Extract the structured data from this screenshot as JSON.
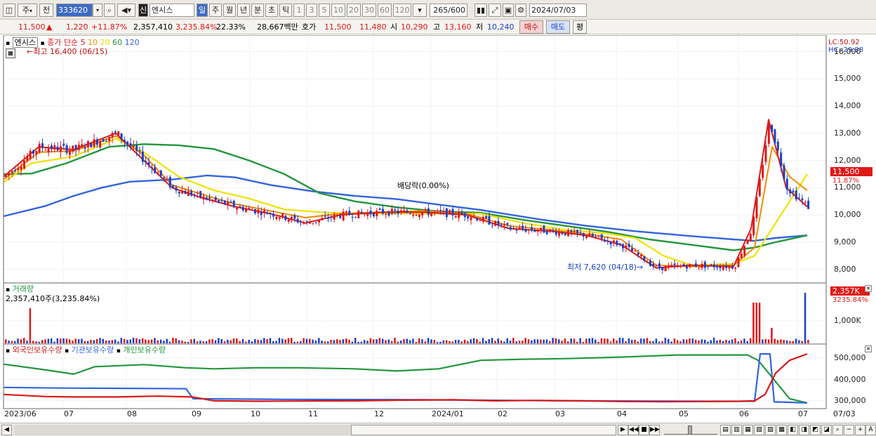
{
  "toolbar": {
    "market_type": "주",
    "prev_label": "전",
    "code": "333620",
    "stock_name": "엔시스",
    "period_tabs": [
      "일",
      "주",
      "월",
      "년",
      "분",
      "초",
      "틱"
    ],
    "interval_buttons": [
      "1",
      "3",
      "5",
      "10",
      "20",
      "30",
      "60",
      "120"
    ],
    "count": "265",
    "count_max": "/600",
    "date": "2024/07/03",
    "badge": "신"
  },
  "quote": {
    "price": "11,500",
    "arrow": "▲",
    "change": "1,220",
    "change_pct": "+11.87%",
    "volume": "2,357,410",
    "volume_ratio": "3,235.84%",
    "turnover": "22.33%",
    "amount": "28,667백만",
    "bid_label": "호가",
    "ask_price": "11,500",
    "bid_price": "11,480",
    "open_label": "시",
    "open": "10,290",
    "high_label": "고",
    "high": "13,160",
    "low_label": "저",
    "low": "10,240",
    "buy_button": "매수",
    "sell_button": "매도",
    "eval_button": "평"
  },
  "price_panel": {
    "name_tag": "엔시스",
    "legend_prefix": "종가 단순",
    "ma_labels": [
      {
        "label": "5",
        "color": "#e01818"
      },
      {
        "label": "10",
        "color": "#f08c00"
      },
      {
        "label": "20",
        "color": "#e8d800"
      },
      {
        "label": "60",
        "color": "#23963c"
      },
      {
        "label": "120",
        "color": "#3264dc"
      }
    ],
    "high_note": "최고 16,400 (06/15)",
    "low_note": "최저 7,620 (04/18)",
    "dividend_note": "배당락(0.00%)",
    "lc": "LC:50.92",
    "hc": "HC:-29.88",
    "current_price_tag": "11,500",
    "current_pct_tag": "11.87%",
    "y_ticks": [
      "16,000",
      "15,000",
      "14,000",
      "13,000",
      "12,000",
      "11,000",
      "10,000",
      "9,000",
      "8,000"
    ]
  },
  "volume_panel": {
    "title": "거래량",
    "value": "2,357,410주(3,235.84%)",
    "tag_value": "2,357K",
    "tag_pct": "3235.84%",
    "y_ticks": [
      "1,000K"
    ]
  },
  "holding_panel": {
    "legend": [
      {
        "label": "외국인보유수량",
        "color": "#d81818"
      },
      {
        "label": "기관보유수량",
        "color": "#3264dc"
      },
      {
        "label": "개인보유수량",
        "color": "#23963c"
      }
    ],
    "y_ticks": [
      "500,000",
      "400,000",
      "300,000"
    ]
  },
  "x_axis": [
    "2023/06",
    "07",
    "08",
    "09",
    "10",
    "11",
    "12",
    "2024/01",
    "02",
    "03",
    "04",
    "05",
    "06",
    "07",
    "07/03"
  ],
  "colors": {
    "up": "#e01818",
    "down": "#1c3fc8",
    "ma5": "#e01818",
    "ma10": "#f08c00",
    "ma20": "#f0e000",
    "ma60": "#23963c",
    "ma120": "#3264dc"
  },
  "chart_data": {
    "type": "candlestick",
    "ylim": [
      7500,
      16400
    ],
    "ma120": [
      [
        0,
        9950
      ],
      [
        60,
        10330
      ],
      [
        100,
        10700
      ],
      [
        140,
        11000
      ],
      [
        180,
        11220
      ],
      [
        240,
        11300
      ],
      [
        290,
        11450
      ],
      [
        330,
        11380
      ],
      [
        380,
        11100
      ],
      [
        440,
        10870
      ],
      [
        500,
        10700
      ],
      [
        560,
        10580
      ],
      [
        620,
        10380
      ],
      [
        680,
        10180
      ],
      [
        760,
        9850
      ],
      [
        830,
        9600
      ],
      [
        900,
        9400
      ],
      [
        980,
        9220
      ],
      [
        1040,
        9100
      ],
      [
        1070,
        9050
      ],
      [
        1100,
        9150
      ],
      [
        1145,
        9250
      ]
    ],
    "ma60": [
      [
        0,
        11500
      ],
      [
        40,
        11520
      ],
      [
        90,
        11900
      ],
      [
        150,
        12500
      ],
      [
        200,
        12600
      ],
      [
        250,
        12560
      ],
      [
        300,
        12420
      ],
      [
        350,
        12000
      ],
      [
        400,
        11500
      ],
      [
        450,
        10800
      ],
      [
        500,
        10500
      ],
      [
        560,
        10280
      ],
      [
        620,
        10130
      ],
      [
        680,
        10080
      ],
      [
        740,
        9820
      ],
      [
        800,
        9600
      ],
      [
        860,
        9380
      ],
      [
        920,
        9100
      ],
      [
        980,
        8900
      ],
      [
        1040,
        8700
      ],
      [
        1070,
        8800
      ],
      [
        1100,
        9000
      ],
      [
        1145,
        9250
      ]
    ],
    "ma20": [
      [
        0,
        11200
      ],
      [
        40,
        11900
      ],
      [
        100,
        12150
      ],
      [
        160,
        12800
      ],
      [
        200,
        12300
      ],
      [
        250,
        11400
      ],
      [
        300,
        10900
      ],
      [
        350,
        10600
      ],
      [
        400,
        10200
      ],
      [
        450,
        10100
      ],
      [
        500,
        10050
      ],
      [
        560,
        10050
      ],
      [
        620,
        10050
      ],
      [
        680,
        10050
      ],
      [
        740,
        9700
      ],
      [
        800,
        9450
      ],
      [
        860,
        9320
      ],
      [
        900,
        9150
      ],
      [
        940,
        8500
      ],
      [
        980,
        8150
      ],
      [
        1040,
        8200
      ],
      [
        1070,
        8500
      ],
      [
        1100,
        9700
      ],
      [
        1145,
        11500
      ]
    ],
    "ma10": [
      [
        0,
        11300
      ],
      [
        50,
        12300
      ],
      [
        100,
        12350
      ],
      [
        160,
        12900
      ],
      [
        200,
        12200
      ],
      [
        240,
        11100
      ],
      [
        290,
        10700
      ],
      [
        330,
        10400
      ],
      [
        380,
        10150
      ],
      [
        430,
        9900
      ],
      [
        480,
        10050
      ],
      [
        540,
        10100
      ],
      [
        600,
        10150
      ],
      [
        660,
        10050
      ],
      [
        720,
        9600
      ],
      [
        780,
        9450
      ],
      [
        830,
        9300
      ],
      [
        880,
        9100
      ],
      [
        930,
        8150
      ],
      [
        980,
        8100
      ],
      [
        1040,
        8150
      ],
      [
        1070,
        8800
      ],
      [
        1095,
        12500
      ],
      [
        1120,
        11400
      ],
      [
        1145,
        10900
      ]
    ],
    "ma5": [
      [
        0,
        11400
      ],
      [
        50,
        12500
      ],
      [
        100,
        12400
      ],
      [
        160,
        13000
      ],
      [
        200,
        12000
      ],
      [
        240,
        11000
      ],
      [
        280,
        10650
      ],
      [
        330,
        10300
      ],
      [
        380,
        10050
      ],
      [
        430,
        9700
      ],
      [
        480,
        10000
      ],
      [
        540,
        10100
      ],
      [
        600,
        10100
      ],
      [
        660,
        10000
      ],
      [
        720,
        9500
      ],
      [
        780,
        9400
      ],
      [
        830,
        9250
      ],
      [
        880,
        8900
      ],
      [
        930,
        8050
      ],
      [
        980,
        8150
      ],
      [
        1040,
        8100
      ],
      [
        1065,
        9500
      ],
      [
        1090,
        13500
      ],
      [
        1115,
        11000
      ],
      [
        1145,
        10300
      ]
    ],
    "holding_foreign": [
      [
        0,
        330000
      ],
      [
        60,
        320000
      ],
      [
        100,
        318000
      ],
      [
        160,
        318000
      ],
      [
        220,
        322000
      ],
      [
        270,
        318000
      ],
      [
        300,
        300000
      ],
      [
        360,
        298000
      ],
      [
        420,
        299000
      ],
      [
        500,
        300000
      ],
      [
        560,
        303000
      ],
      [
        640,
        305000
      ],
      [
        700,
        300000
      ],
      [
        760,
        302000
      ],
      [
        820,
        300000
      ],
      [
        880,
        297000
      ],
      [
        940,
        296000
      ],
      [
        1000,
        297000
      ],
      [
        1050,
        298000
      ],
      [
        1070,
        300000
      ],
      [
        1085,
        330000
      ],
      [
        1100,
        430000
      ],
      [
        1120,
        490000
      ],
      [
        1145,
        520000
      ]
    ],
    "holding_inst": [
      [
        0,
        363000
      ],
      [
        80,
        360000
      ],
      [
        260,
        357000
      ],
      [
        270,
        310000
      ],
      [
        400,
        307000
      ],
      [
        600,
        305000
      ],
      [
        800,
        300000
      ],
      [
        1000,
        298000
      ],
      [
        1070,
        298000
      ],
      [
        1078,
        520000
      ],
      [
        1092,
        520000
      ],
      [
        1098,
        295000
      ],
      [
        1120,
        293000
      ],
      [
        1145,
        290000
      ]
    ],
    "holding_indiv": [
      [
        0,
        472000
      ],
      [
        60,
        445000
      ],
      [
        100,
        425000
      ],
      [
        130,
        460000
      ],
      [
        200,
        470000
      ],
      [
        260,
        455000
      ],
      [
        300,
        450000
      ],
      [
        360,
        455000
      ],
      [
        420,
        455000
      ],
      [
        500,
        450000
      ],
      [
        560,
        440000
      ],
      [
        620,
        450000
      ],
      [
        680,
        490000
      ],
      [
        740,
        495000
      ],
      [
        800,
        498000
      ],
      [
        880,
        505000
      ],
      [
        960,
        515000
      ],
      [
        1060,
        515000
      ],
      [
        1075,
        490000
      ],
      [
        1100,
        390000
      ],
      [
        1120,
        310000
      ],
      [
        1145,
        290000
      ]
    ]
  }
}
